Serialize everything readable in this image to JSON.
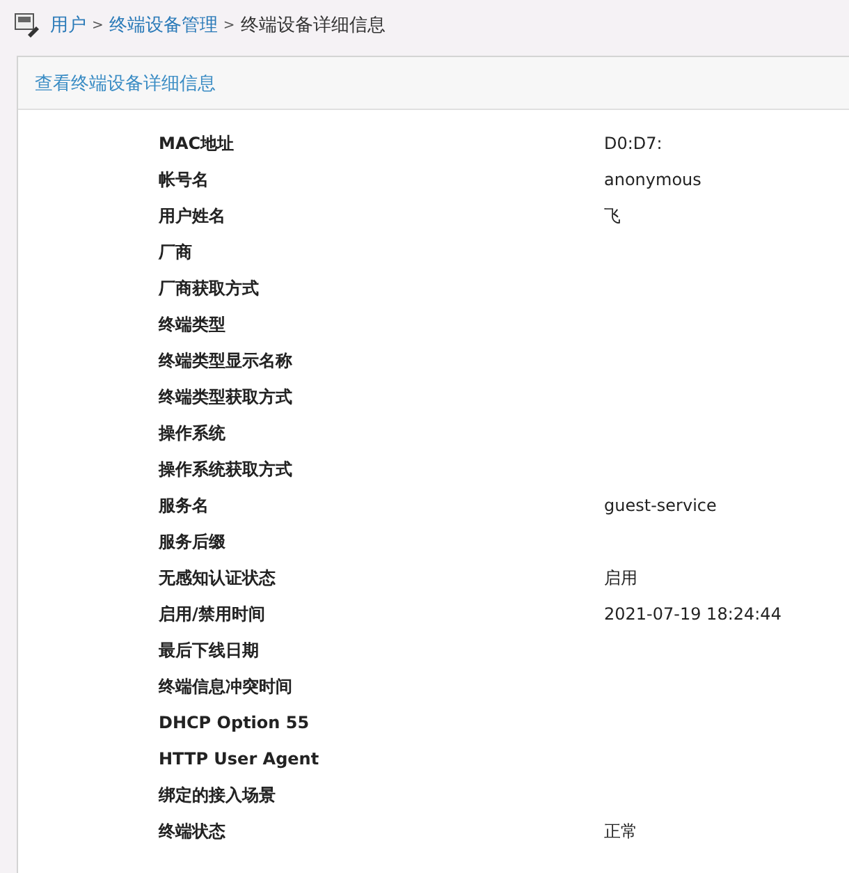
{
  "breadcrumb": [
    {
      "label": "用户",
      "link": true
    },
    {
      "label": "终端设备管理",
      "link": true
    },
    {
      "label": "终端设备详细信息",
      "link": false
    }
  ],
  "breadcrumb_separator": ">",
  "panel": {
    "title": "查看终端设备详细信息"
  },
  "fields": [
    {
      "label": "MAC地址",
      "value": "D0:D7:"
    },
    {
      "label": "帐号名",
      "value": "anonymous"
    },
    {
      "label": "用户姓名",
      "value": "飞"
    },
    {
      "label": "厂商"
    },
    {
      "label": "厂商获取方式"
    },
    {
      "label": "终端类型"
    },
    {
      "label": "终端类型显示名称"
    },
    {
      "label": "终端类型获取方式"
    },
    {
      "label": "操作系统"
    },
    {
      "label": "操作系统获取方式"
    },
    {
      "label": "服务名",
      "value": "guest-service"
    },
    {
      "label": "服务后缀"
    },
    {
      "label": "无感知认证状态",
      "value": "启用"
    },
    {
      "label": "启用/禁用时间",
      "value": "2021-07-19 18:24:44"
    },
    {
      "label": "最后下线日期"
    },
    {
      "label": "终端信息冲突时间"
    },
    {
      "label": "DHCP Option 55"
    },
    {
      "label": "HTTP User Agent"
    },
    {
      "label": "绑定的接入场景"
    },
    {
      "label": "终端状态",
      "value": "正常"
    }
  ]
}
